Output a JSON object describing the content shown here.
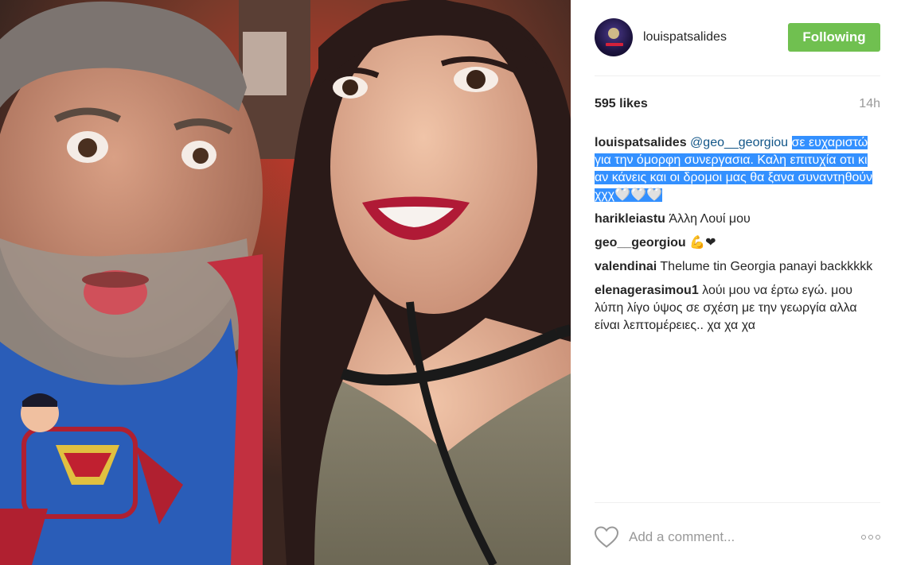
{
  "post": {
    "username": "louispatsalides",
    "follow_label": "Following",
    "likes": "595 likes",
    "time": "14h"
  },
  "comments": [
    {
      "user": "louispatsalides",
      "mention": "@geo__georgiou",
      "text": "σε ευχαριστώ για την όμορφη συνεργασια. Καλη επιτυχία οτι κι αν κάνεις και οι δρομοι μας θα ξανα συναντηθούν χχχ🤍🤍🤍"
    },
    {
      "user": "harikleiastu",
      "text": "Άλλη Λουί μου"
    },
    {
      "user": "geo__georgiou",
      "text": "💪❤"
    },
    {
      "user": "valendinai",
      "text": "Thelume tin Georgia panayi backkkkk"
    },
    {
      "user": "elenagerasimou1",
      "text": "λούι μου να έρτω εγώ. μου λύπη λίγο ύψος σε σχέση με την γεωργία αλλα είναι λεπτομέρειες.. χα χα χα"
    }
  ],
  "add_comment_placeholder": "Add a comment...",
  "icons": {
    "avatar": "profile-avatar",
    "like": "heart-icon",
    "more": "more-options-icon"
  },
  "colors": {
    "follow_button": "#70c050",
    "mention": "#125688",
    "selection": "#3390ff"
  }
}
